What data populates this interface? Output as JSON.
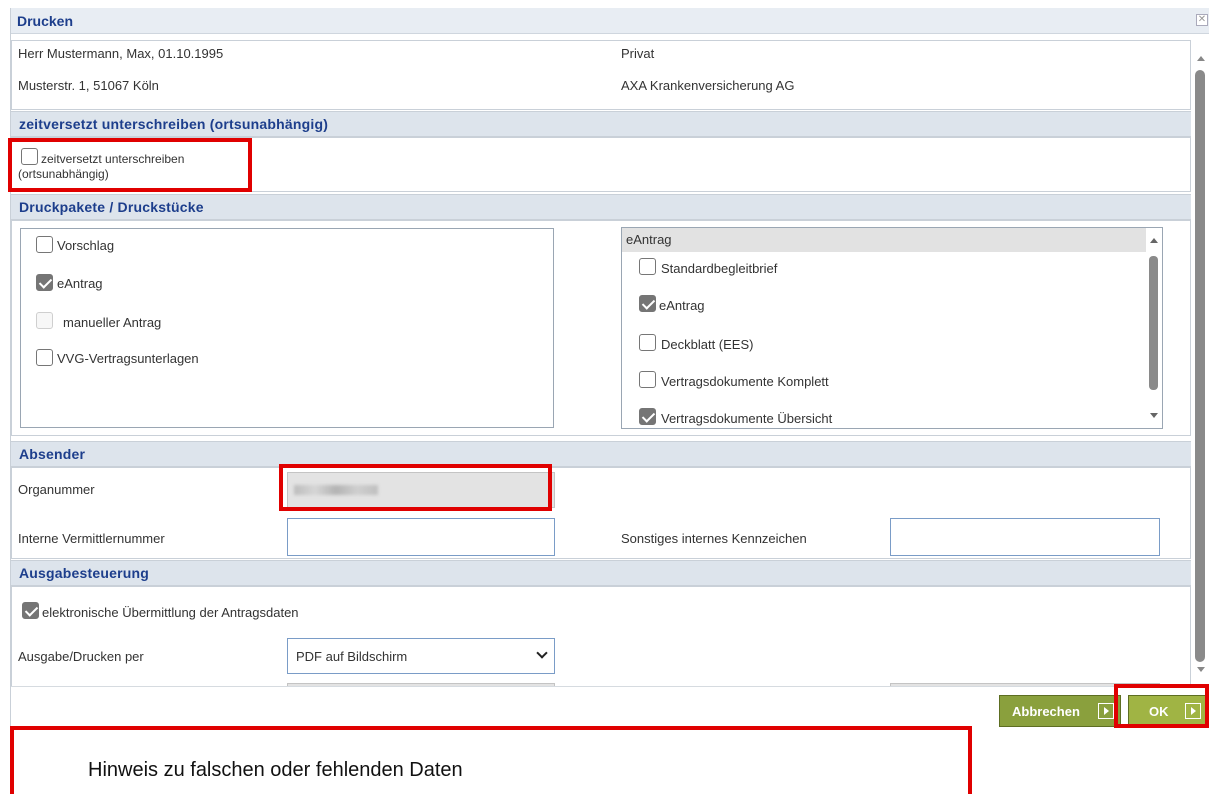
{
  "dialog": {
    "title": "Drucken",
    "close_label": "✕"
  },
  "customer": {
    "name": "Herr Mustermann, Max, 01.10.1995",
    "insurance_type": "Privat",
    "address": "Musterstr. 1, 51067 Köln",
    "insurer": "AXA Krankenversicherung AG"
  },
  "sections": {
    "delayed_sign": "zeitversetzt unterschreiben (ortsunabhängig)",
    "packages": "Druckpakete / Druckstücke",
    "sender": "Absender",
    "output": "Ausgabesteuerung"
  },
  "delayed_sign": {
    "checkbox_line1": "zeitversetzt unterschreiben",
    "checkbox_line2": "(ortsunabhängig)",
    "checked": false
  },
  "packages": {
    "items": [
      {
        "label": "Vorschlag",
        "checked": false,
        "disabled": false
      },
      {
        "label": "eAntrag",
        "checked": true,
        "disabled": false
      },
      {
        "label": "manueller Antrag",
        "checked": false,
        "disabled": true
      },
      {
        "label": "VVG-Vertragsunterlagen",
        "checked": false,
        "disabled": false
      }
    ],
    "list_title": "eAntrag",
    "list_items": [
      {
        "label": "Standardbegleitbrief",
        "checked": false
      },
      {
        "label": "eAntrag",
        "checked": true
      },
      {
        "label": "Deckblatt (EES)",
        "checked": false
      },
      {
        "label": "Vertragsdokumente Komplett",
        "checked": false
      },
      {
        "label": "Vertragsdokumente Übersicht",
        "checked": true
      }
    ]
  },
  "sender": {
    "org_label": "Organummer",
    "intermediary_label": "Interne Vermittlernummer",
    "other_label": "Sonstiges internes Kennzeichen"
  },
  "output": {
    "electronic_label": "elektronische Übermittlung der Antragsdaten",
    "electronic_checked": true,
    "print_label": "Ausgabe/Drucken per",
    "print_value": "PDF auf Bildschirm"
  },
  "buttons": {
    "cancel": "Abbrechen",
    "ok": "OK"
  },
  "hint": "Hinweis zu falschen oder fehlenden Daten",
  "colors": {
    "section_title": "#1d3e8c",
    "section_bg": "#dde4ec",
    "button_green": "#8aa03d",
    "highlight_red": "#e00000"
  }
}
